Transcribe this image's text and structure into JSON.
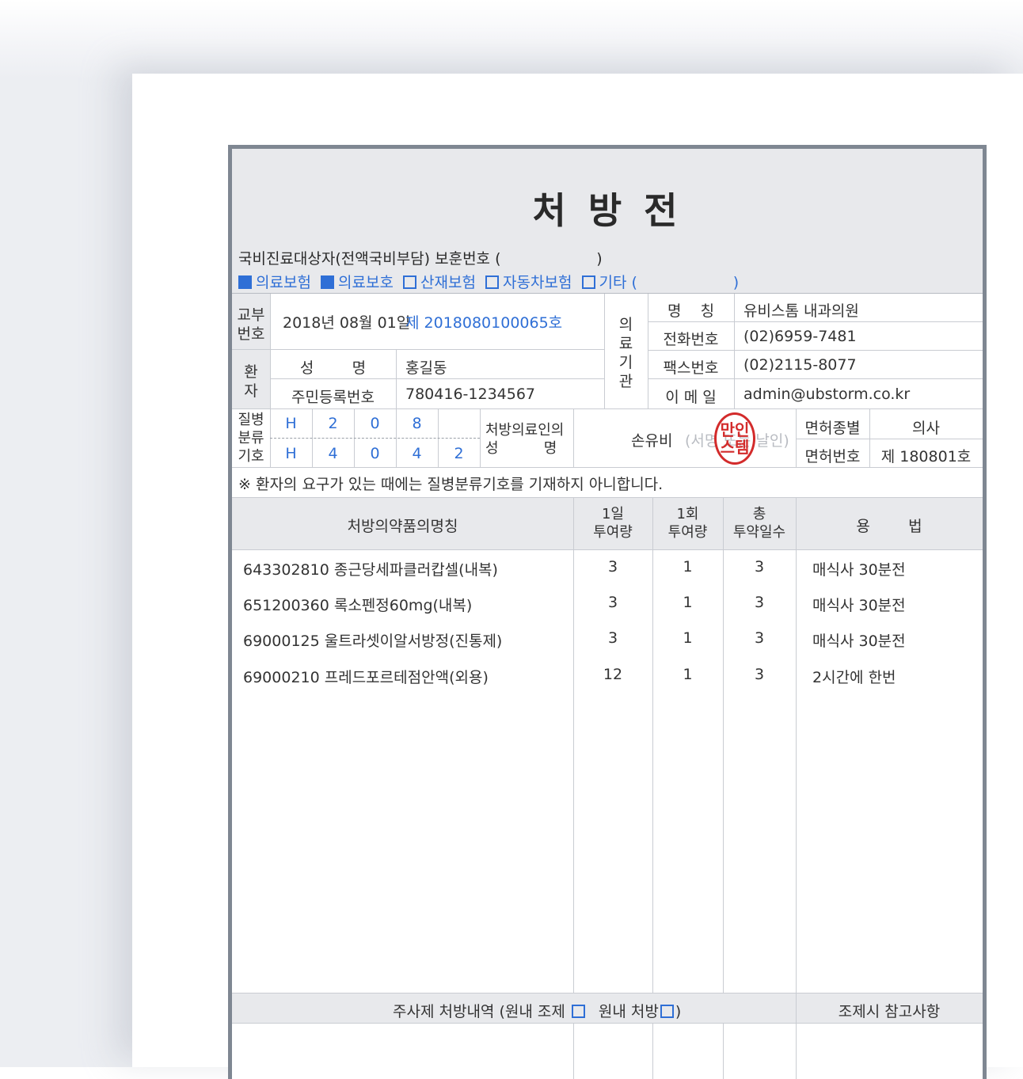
{
  "title": "처 방 전",
  "subtitle": "국비진료대상자(전액국비부담) 보훈번호 (                    )",
  "insurance": [
    {
      "label": "의료보험",
      "checked": true
    },
    {
      "label": "의료보호",
      "checked": true
    },
    {
      "label": "산재보험",
      "checked": false
    },
    {
      "label": "자동차보험",
      "checked": false
    },
    {
      "label": "기타 (                    )",
      "checked": false
    }
  ],
  "issue": {
    "header": "교부\n번호",
    "date": "2018년 08월 01일",
    "number": "제 2018080100065호"
  },
  "patient": {
    "header": "환\n자",
    "name_label": "성        명",
    "name": "홍길동",
    "rrn_label": "주민등록번호",
    "rrn": "780416-1234567"
  },
  "institution": {
    "header": "의\n료\n기\n관",
    "rows": [
      {
        "label": "명    칭",
        "value": "유비스톰 내과의원"
      },
      {
        "label": "전화번호",
        "value": "(02)6959-7481"
      },
      {
        "label": "팩스번호",
        "value": "(02)2115-8077"
      },
      {
        "label": "이 메 일",
        "value": "admin@ubstorm.co.kr"
      }
    ]
  },
  "disease": {
    "header": "질병\n분류\n기호",
    "row1": [
      "H",
      "2",
      "0",
      "8",
      ""
    ],
    "row2": [
      "H",
      "4",
      "0",
      "4",
      "2"
    ]
  },
  "doctor": {
    "label": "처방의료인의\n성          명",
    "name": "손유비",
    "sign_hint": "(서명 또는 날인)",
    "seal_text": "만인\n스템",
    "license_type_label": "면허종별",
    "license_type": "의사",
    "license_no_label": "면허번호",
    "license_no": "제 180801호"
  },
  "notice": "※ 환자의 요구가 있는 때에는 질병분류기호를 기재하지 아니합니다.",
  "columns": {
    "name": "처방의약품의명칭",
    "daily": "1일\n투여량",
    "dose": "1회\n투여량",
    "days": "총\n투약일수",
    "usage": "용        법"
  },
  "drugs": [
    {
      "name": "643302810 종근당세파클러캅셀(내복)",
      "daily": "3",
      "dose": "1",
      "days": "3",
      "usage": "매식사 30분전"
    },
    {
      "name": "651200360 록소펜정60mg(내복)",
      "daily": "3",
      "dose": "1",
      "days": "3",
      "usage": "매식사 30분전"
    },
    {
      "name": "69000125 울트라셋이알서방정(진통제)",
      "daily": "3",
      "dose": "1",
      "days": "3",
      "usage": "매식사 30분전"
    },
    {
      "name": "69000210 프레드포르테점안액(외용)",
      "daily": "12",
      "dose": "1",
      "days": "3",
      "usage": "2시간에 한번"
    }
  ],
  "injection": {
    "label": "주사제 처방내역 (원내 조제",
    "label2": "원내 처방",
    "close": ")",
    "note": "조제시 참고사항"
  },
  "colors": {
    "accent": "#2f6fd6",
    "seal": "#d32b2b",
    "frame": "#7f8792",
    "header_bg": "#e8e9ec"
  }
}
